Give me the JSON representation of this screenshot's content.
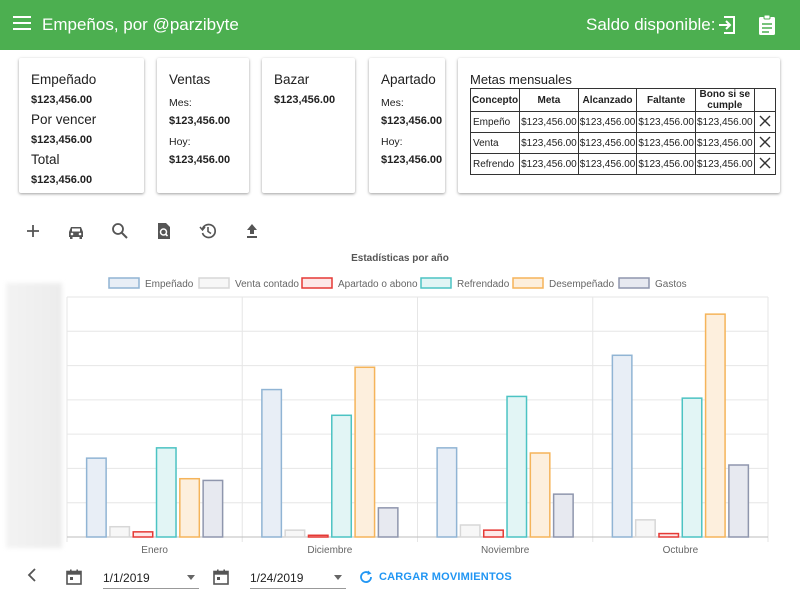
{
  "appbar": {
    "title": "Empeños, por @parzibyte",
    "balance_label": "Saldo disponible:"
  },
  "cards": {
    "empenado": {
      "label": "Empeñado",
      "value": "$123,456.00",
      "por_vencer_label": "Por vencer",
      "por_vencer_value": "$123,456.00",
      "total_label": "Total",
      "total_value": "$123,456.00"
    },
    "ventas": {
      "label": "Ventas",
      "mes_label": "Mes:",
      "mes_value": "$123,456.00",
      "hoy_label": "Hoy:",
      "hoy_value": "$123,456.00"
    },
    "bazar": {
      "label": "Bazar",
      "value": "$123,456.00"
    },
    "apartado": {
      "label": "Apartado",
      "mes_label": "Mes:",
      "mes_value": "$123,456.00",
      "hoy_label": "Hoy:",
      "hoy_value": "$123,456.00"
    }
  },
  "metas": {
    "title": "Metas mensuales",
    "headers": [
      "Concepto",
      "Meta",
      "Alcanzado",
      "Faltante",
      "Bono si se cumple"
    ],
    "rows": [
      [
        "Empeño",
        "$123,456.00",
        "$123,456.00",
        "$123,456.00",
        "$123,456.00"
      ],
      [
        "Venta",
        "$123,456.00",
        "$123,456.00",
        "$123,456.00",
        "$123,456.00"
      ],
      [
        "Refrendo",
        "$123,456.00",
        "$123,456.00",
        "$123,456.00",
        "$123,456.00"
      ]
    ]
  },
  "toolbar_icons": [
    "add-icon",
    "car-icon",
    "search-icon",
    "find-in-page-icon",
    "history-icon",
    "upload-icon"
  ],
  "chart_data": {
    "type": "bar",
    "title": "Estadísticas por año",
    "categories": [
      "Enero",
      "Diciembre",
      "Noviembre",
      "Octubre"
    ],
    "series": [
      {
        "name": "Empeñado",
        "color": "#90b4d4",
        "fill": "#e8eef6",
        "values": [
          23,
          43,
          26,
          53
        ]
      },
      {
        "name": "Venta contado",
        "color": "#d7d7d7",
        "fill": "#f7f7f7",
        "values": [
          3,
          2,
          3.5,
          5
        ]
      },
      {
        "name": "Apartado o abono",
        "color": "#e53935",
        "fill": "#fde8e8",
        "values": [
          1.5,
          0.5,
          2,
          1
        ]
      },
      {
        "name": "Refrendado",
        "color": "#4cc3c3",
        "fill": "#e2f5f5",
        "values": [
          26,
          35.5,
          41,
          40.5
        ]
      },
      {
        "name": "Desempeñado",
        "color": "#f5b45a",
        "fill": "#fdefdd",
        "values": [
          17,
          49.5,
          24.5,
          65
        ]
      },
      {
        "name": "Gastos",
        "color": "#8f96ad",
        "fill": "#e7e9f0",
        "values": [
          16.5,
          8.5,
          12.5,
          21
        ]
      }
    ],
    "ylim": [
      0,
      70
    ],
    "grid": true,
    "legend": "top"
  },
  "footer": {
    "from_date": "1/1/2019",
    "to_date": "1/24/2019",
    "load_label": "CARGAR MOVIMIENTOS"
  }
}
